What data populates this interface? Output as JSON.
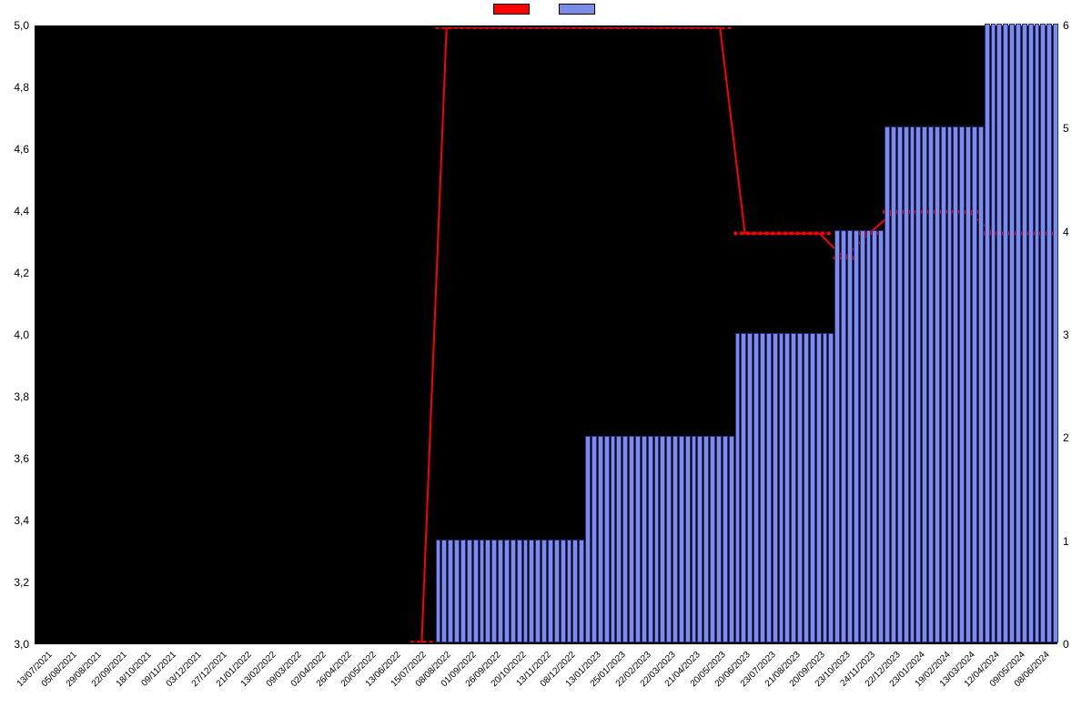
{
  "chart_data": {
    "type": "bar+line",
    "categories": [
      "13/07/2021",
      "05/08/2021",
      "29/08/2021",
      "22/09/2021",
      "18/10/2021",
      "09/11/2021",
      "03/12/2021",
      "27/12/2021",
      "21/01/2022",
      "13/02/2022",
      "09/03/2022",
      "02/04/2022",
      "26/04/2022",
      "20/05/2022",
      "13/06/2022",
      "15/07/2022",
      "08/08/2022",
      "01/09/2022",
      "26/09/2022",
      "20/10/2022",
      "13/11/2022",
      "08/12/2022",
      "13/01/2023",
      "25/01/2023",
      "22/02/2023",
      "22/03/2023",
      "21/04/2023",
      "20/05/2023",
      "20/06/2023",
      "23/07/2023",
      "21/08/2023",
      "20/09/2023",
      "23/10/2023",
      "24/11/2023",
      "22/12/2023",
      "23/01/2024",
      "19/02/2024",
      "13/03/2024",
      "12/04/2024",
      "09/05/2024",
      "08/06/2024"
    ],
    "left_axis": {
      "label": "",
      "min": 3.0,
      "max": 5.0,
      "ticks": [
        3.0,
        3.2,
        3.4,
        3.6,
        3.8,
        4.0,
        4.2,
        4.4,
        4.6,
        4.8,
        5.0
      ]
    },
    "right_axis": {
      "label": "",
      "min": 0,
      "max": 6,
      "ticks": [
        0,
        1,
        2,
        3,
        4,
        5,
        6
      ]
    },
    "series": [
      {
        "name": "",
        "type": "line",
        "axis": "left",
        "values": [
          null,
          null,
          null,
          null,
          null,
          null,
          null,
          null,
          null,
          null,
          null,
          null,
          null,
          null,
          null,
          3.0,
          5.0,
          5.0,
          5.0,
          5.0,
          5.0,
          5.0,
          5.0,
          5.0,
          5.0,
          5.0,
          5.0,
          5.0,
          4.33,
          4.33,
          4.33,
          4.33,
          4.25,
          4.33,
          4.4,
          4.4,
          4.4,
          4.4,
          4.33,
          4.33,
          4.33
        ]
      },
      {
        "name": "",
        "type": "bar",
        "axis": "right",
        "values": [
          0,
          0,
          0,
          0,
          0,
          0,
          0,
          0,
          0,
          0,
          0,
          0,
          0,
          0,
          0,
          0,
          1,
          1,
          1,
          1,
          1,
          1,
          2,
          2,
          2,
          2,
          2,
          2,
          3,
          3,
          3,
          3,
          4,
          4,
          5,
          5,
          5,
          5,
          6,
          6,
          6
        ]
      }
    ],
    "legend": [
      "",
      ""
    ]
  }
}
